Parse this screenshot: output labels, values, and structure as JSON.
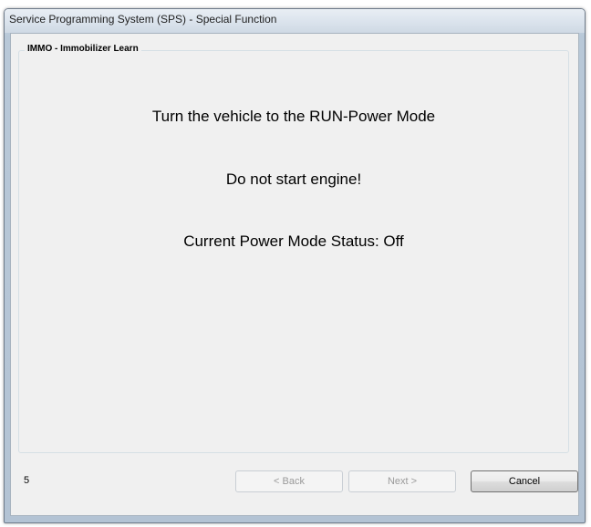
{
  "window": {
    "title": "Service Programming System (SPS) - Special Function"
  },
  "group": {
    "legend": "IMMO - Immobilizer Learn"
  },
  "messages": {
    "instruction": "Turn the vehicle to the RUN-Power Mode",
    "warning": "Do not start engine!",
    "status": "Current Power Mode Status: Off"
  },
  "footer": {
    "step_number": "5",
    "back_label": "< Back",
    "next_label": "Next >",
    "cancel_label": "Cancel"
  }
}
